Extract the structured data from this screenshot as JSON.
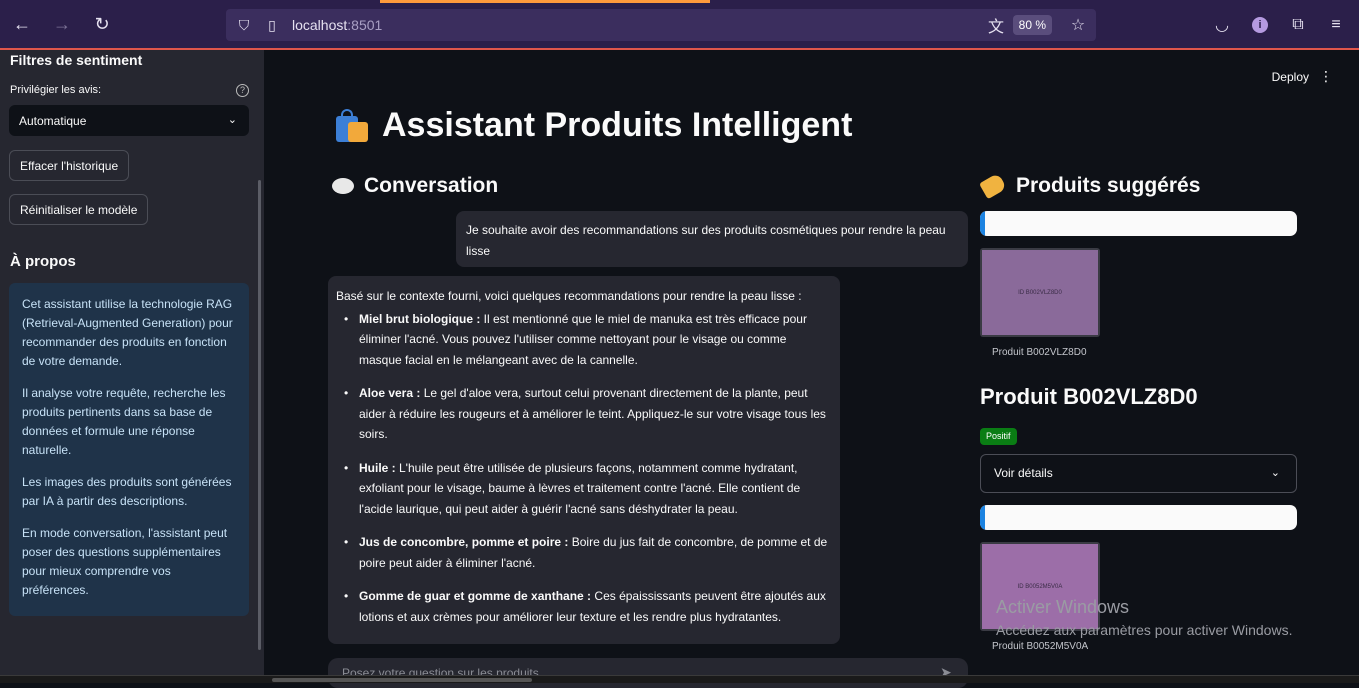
{
  "browser": {
    "url_host": "localhost",
    "url_port": ":8501",
    "zoom": "80 %"
  },
  "sidebar": {
    "title": "Filtres de sentiment",
    "filter_label": "Privilégier les avis:",
    "filter_value": "Automatique",
    "help": "?",
    "clear_history": "Effacer l'historique",
    "reset_model": "Réinitialiser le modèle",
    "about_title": "À propos",
    "about_paragraphs": [
      "Cet assistant utilise la technologie RAG (Retrieval-Augmented Generation) pour recommander des produits en fonction de votre demande.",
      "Il analyse votre requête, recherche les produits pertinents dans sa base de données et formule une réponse naturelle.",
      "Les images des produits sont générées par IA à partir des descriptions.",
      "En mode conversation, l'assistant peut poser des questions supplémentaires pour mieux comprendre vos préférences."
    ]
  },
  "header": {
    "deploy": "Deploy",
    "menu": "⋮"
  },
  "main": {
    "title": "Assistant Produits Intelligent",
    "conversation_title": "Conversation",
    "user_message": "Je souhaite avoir des recommandations sur des produits cosmétiques pour rendre la peau lisse",
    "bot_intro": "Basé sur le contexte fourni, voici quelques recommandations pour rendre la peau lisse :",
    "bot_items": [
      {
        "bold": "Miel brut biologique :",
        "text": " Il est mentionné que le miel de manuka est très efficace pour éliminer l'acné. Vous pouvez l'utiliser comme nettoyant pour le visage ou comme masque facial en le mélangeant avec de la cannelle."
      },
      {
        "bold": "Aloe vera :",
        "text": " Le gel d'aloe vera, surtout celui provenant directement de la plante, peut aider à réduire les rougeurs et à améliorer le teint. Appliquez-le sur votre visage tous les soirs."
      },
      {
        "bold": "Huile :",
        "text": " L'huile peut être utilisée de plusieurs façons, notamment comme hydratant, exfoliant pour le visage, baume à lèvres et traitement contre l'acné. Elle contient de l'acide laurique, qui peut aider à guérir l'acné sans déshydrater la peau."
      },
      {
        "bold": "Jus de concombre, pomme et poire :",
        "text": " Boire du jus fait de concombre, de pomme et de poire peut aider à éliminer l'acné."
      },
      {
        "bold": "Gomme de guar et gomme de xanthane :",
        "text": " Ces épaississants peuvent être ajoutés aux lotions et aux crèmes pour améliorer leur texture et les rendre plus hydratantes."
      }
    ],
    "chat_placeholder": "Posez votre question sur les produits..."
  },
  "products": {
    "title": "Produits suggérés",
    "items": [
      {
        "thumb_text": "ID B002VLZ8D0",
        "caption": "Produit B002VLZ8D0",
        "bar_fill": 0.015,
        "thumb_color": "#8a6a9a"
      },
      {
        "thumb_text": "ID B0052M5V0A",
        "caption": "Produit B0052M5V0A",
        "bar_fill": 0.015,
        "thumb_color": "#9c6ea8"
      }
    ],
    "detail_title": "Produit B002VLZ8D0",
    "sentiment": "Positif",
    "details_label": "Voir détails"
  },
  "windows_watermark": {
    "title": "Activer Windows",
    "subtitle": "Accédez aux paramètres pour activer Windows."
  },
  "colors": {
    "accent": "#1c83e1",
    "positive": "#0a7d14",
    "about_bg": "#1f3349"
  }
}
